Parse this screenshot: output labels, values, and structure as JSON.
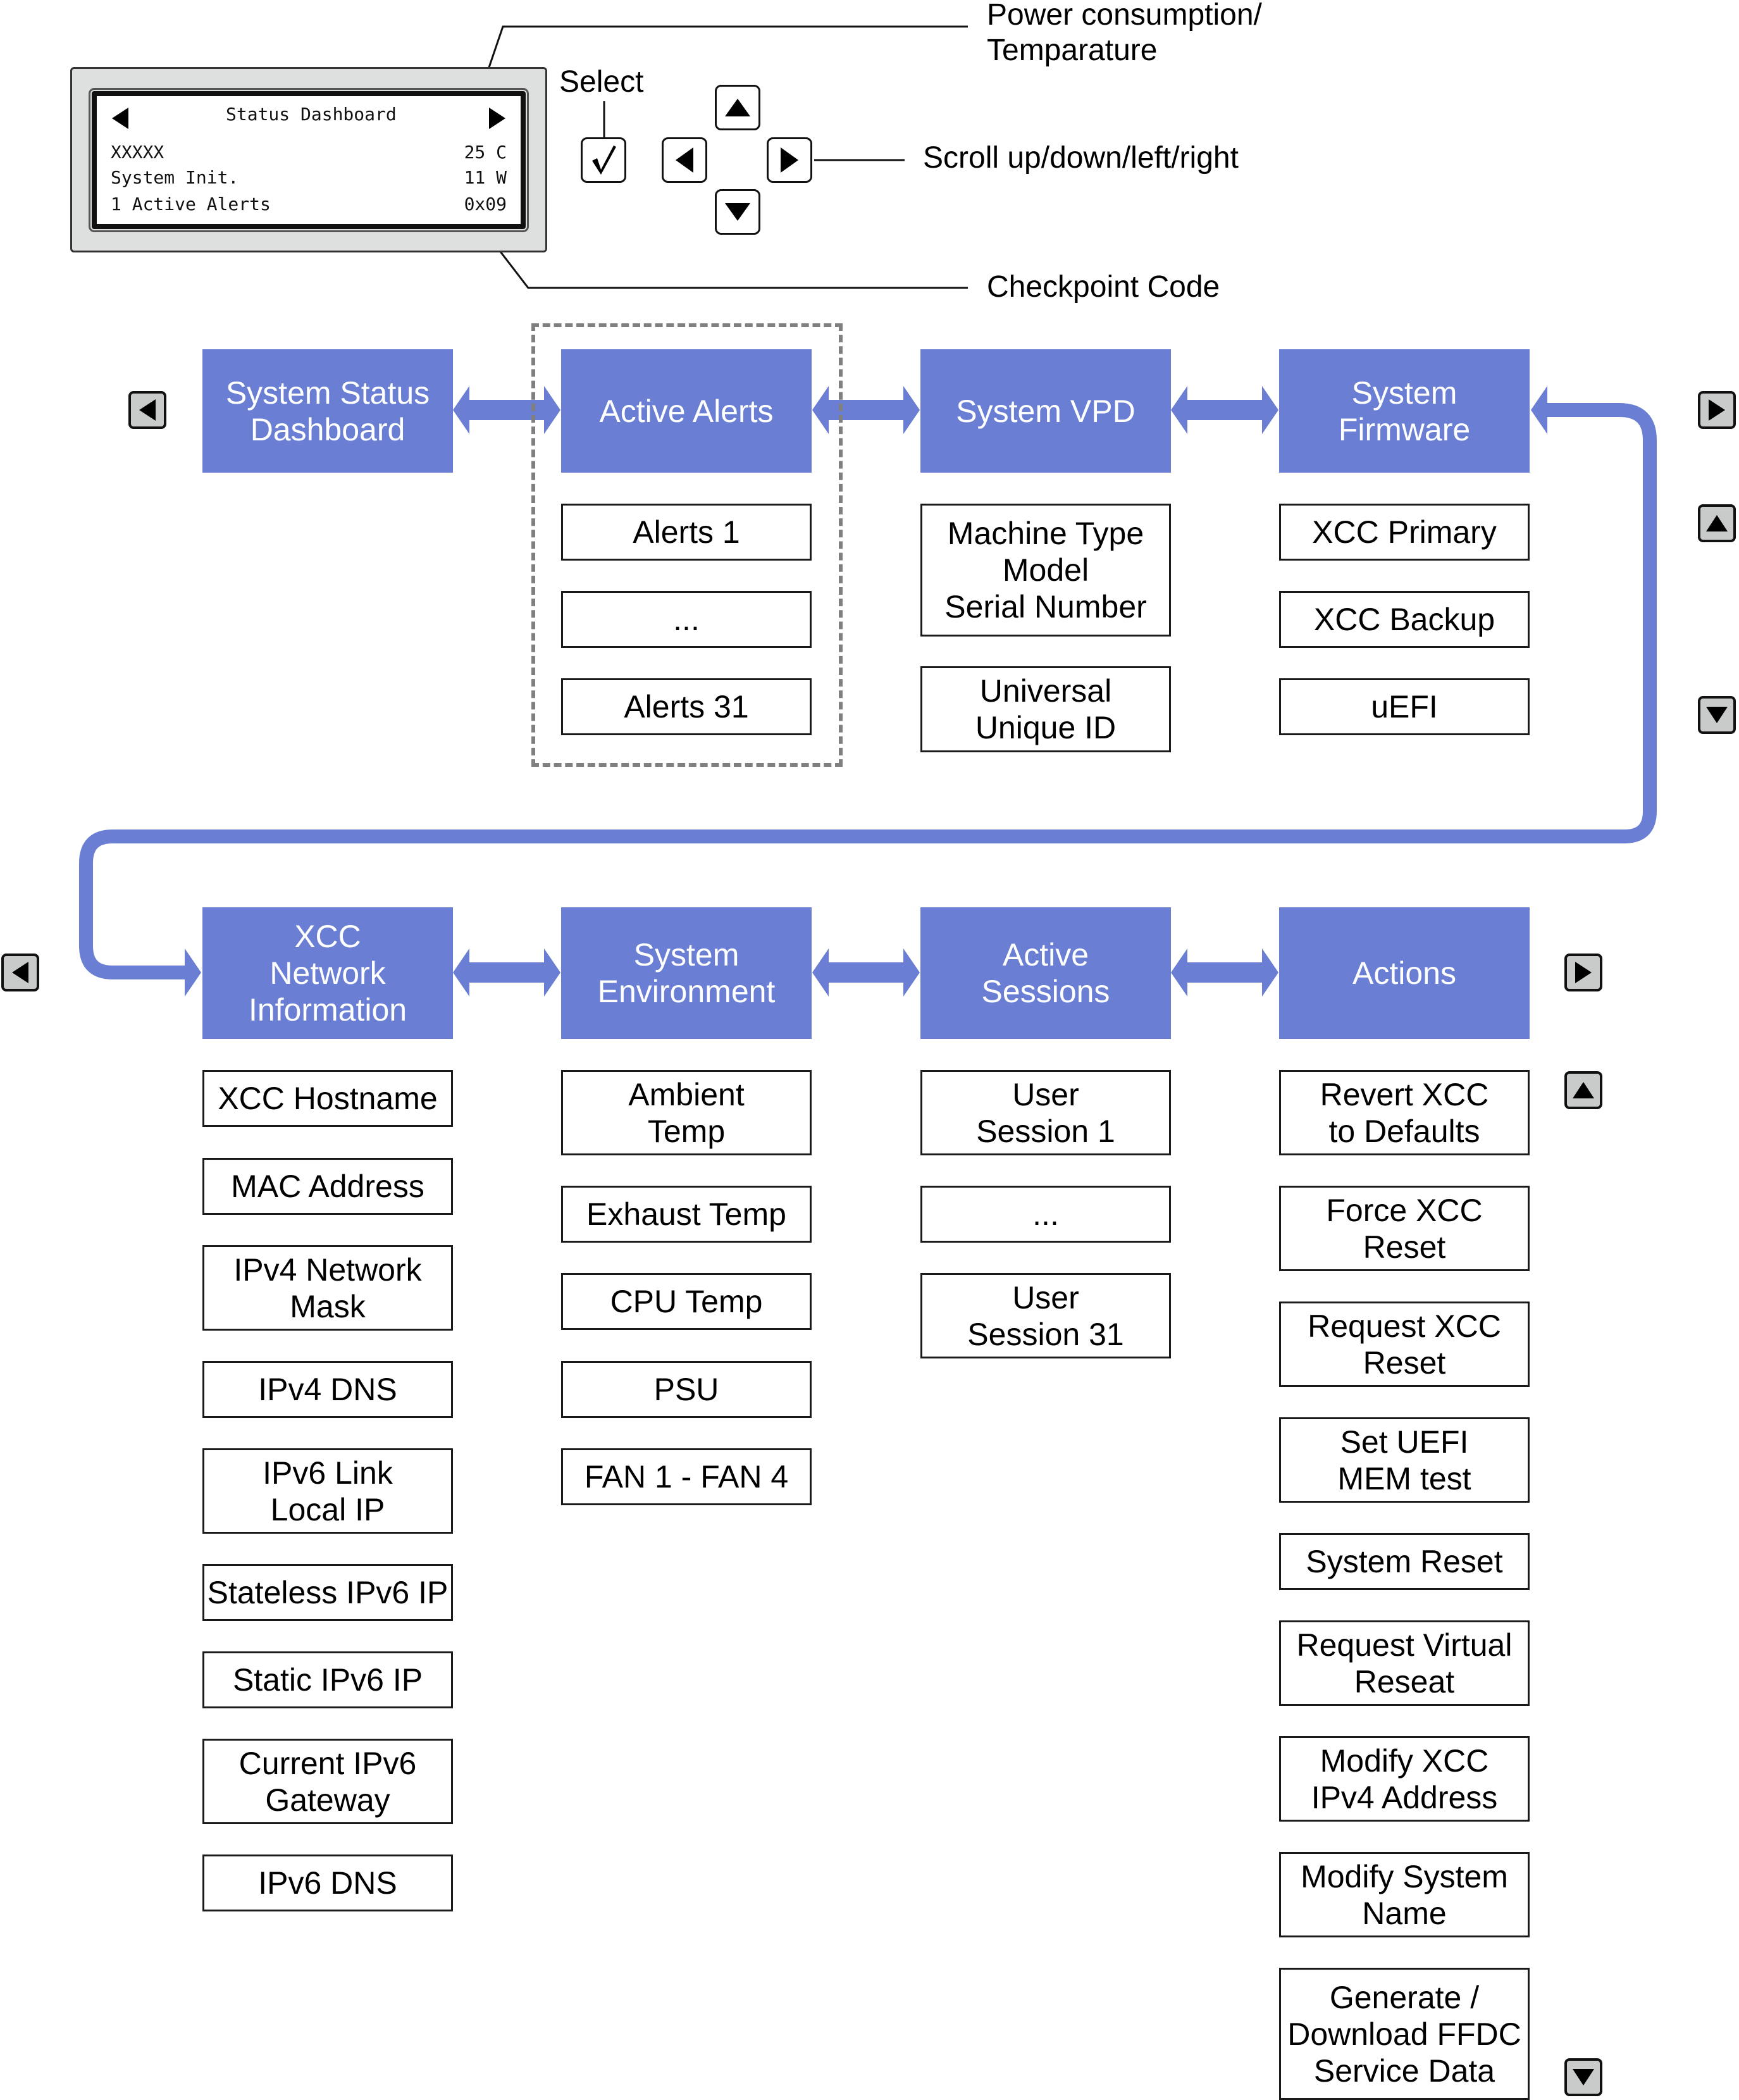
{
  "lcd": {
    "title": "Status Dashboard",
    "rows": [
      {
        "left": "XXXXX",
        "right": "25 C"
      },
      {
        "left": "System Init.",
        "right": "11 W"
      },
      {
        "left": "1 Active Alerts",
        "right": "0x09"
      }
    ]
  },
  "callouts": {
    "power_temp": "Power consumption/\nTemparature",
    "select": "Select",
    "scroll": "Scroll up/down/left/right",
    "checkpoint": "Checkpoint Code"
  },
  "colors": {
    "menu_header": "#6a7fd3",
    "nav_button": "#c9caca",
    "dashed_group": "#808080"
  },
  "icons": {
    "select": "checkmark-icon",
    "scroll_up": "arrow-up-icon",
    "scroll_down": "arrow-down-icon",
    "scroll_left": "arrow-left-icon",
    "scroll_right": "arrow-right-icon"
  },
  "menus": {
    "row1": [
      {
        "title": "System Status\nDashboard",
        "items": []
      },
      {
        "title": "Active Alerts",
        "items": [
          "Alerts 1",
          "...",
          "Alerts 31"
        ]
      },
      {
        "title": "System VPD",
        "items": [
          "Machine Type\nModel\nSerial Number",
          "Universal\nUnique ID"
        ]
      },
      {
        "title": "System\nFirmware",
        "items": [
          "XCC Primary",
          "XCC Backup",
          "uEFI"
        ]
      }
    ],
    "row2": [
      {
        "title": "XCC\nNetwork\nInformation",
        "items": [
          "XCC Hostname",
          "MAC Address",
          "IPv4 Network\nMask",
          "IPv4 DNS",
          "IPv6 Link\nLocal IP",
          "Stateless IPv6 IP",
          "Static IPv6 IP",
          "Current IPv6\nGateway",
          "IPv6 DNS"
        ]
      },
      {
        "title": "System\nEnvironment",
        "items": [
          "Ambient\nTemp",
          "Exhaust Temp",
          "CPU Temp",
          "PSU",
          "FAN 1 - FAN 4"
        ]
      },
      {
        "title": "Active\nSessions",
        "items": [
          "User\nSession 1",
          "...",
          "User\nSession 31"
        ]
      },
      {
        "title": "Actions",
        "items": [
          "Revert XCC\nto Defaults",
          "Force XCC\nReset",
          "Request XCC\nReset",
          "Set UEFI\nMEM test",
          "System Reset",
          "Request Virtual\nReseat",
          "Modify XCC\nIPv4 Address",
          "Modify System\nName",
          "Generate /\nDownload FFDC\nService Data"
        ]
      }
    ]
  }
}
